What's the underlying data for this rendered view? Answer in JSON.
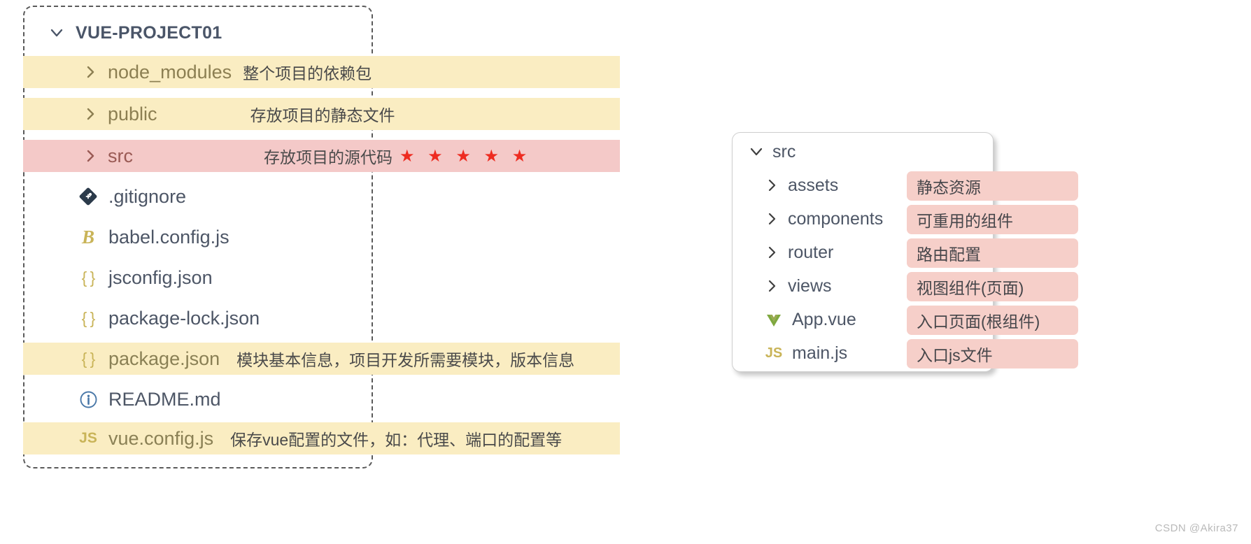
{
  "left_panel": {
    "root": {
      "label": "VUE-PROJECT01",
      "chevron": "chevron-down-icon"
    },
    "rows": [
      {
        "name": "node_modules",
        "note": "整个项目的依赖包",
        "icon": "chevron-right-icon",
        "highlight": "yellow",
        "stars": ""
      },
      {
        "name": "public",
        "note": "存放项目的静态文件",
        "icon": "chevron-right-icon",
        "highlight": "yellow",
        "stars": ""
      },
      {
        "name": "src",
        "note": "存放项目的源代码",
        "icon": "chevron-right-icon",
        "highlight": "pink",
        "stars": "★ ★ ★ ★ ★"
      },
      {
        "name": ".gitignore",
        "note": "",
        "icon": "git-icon",
        "highlight": "none",
        "stars": ""
      },
      {
        "name": "babel.config.js",
        "note": "",
        "icon": "babel-icon",
        "highlight": "none",
        "stars": ""
      },
      {
        "name": "jsconfig.json",
        "note": "",
        "icon": "json-icon",
        "highlight": "none",
        "stars": ""
      },
      {
        "name": "package-lock.json",
        "note": "",
        "icon": "json-icon",
        "highlight": "none",
        "stars": ""
      },
      {
        "name": "package.json",
        "note": "模块基本信息，项目开发所需要模块，版本信息",
        "icon": "json-icon",
        "highlight": "yellow",
        "stars": ""
      },
      {
        "name": "README.md",
        "note": "",
        "icon": "info-icon",
        "highlight": "none",
        "stars": ""
      },
      {
        "name": "vue.config.js",
        "note": "保存vue配置的文件，如：代理、端口的配置等",
        "icon": "js-icon",
        "highlight": "yellow",
        "stars": ""
      }
    ]
  },
  "right_panel": {
    "root": {
      "label": "src",
      "chevron": "chevron-down-icon"
    },
    "rows": [
      {
        "name": "assets",
        "icon": "chevron-right-icon",
        "badge": "静态资源"
      },
      {
        "name": "components",
        "icon": "chevron-right-icon",
        "badge": "可重用的组件"
      },
      {
        "name": "router",
        "icon": "chevron-right-icon",
        "badge": "路由配置"
      },
      {
        "name": "views",
        "icon": "chevron-right-icon",
        "badge": "视图组件(页面)"
      },
      {
        "name": "App.vue",
        "icon": "vue-icon",
        "badge": "入口页面(根组件)"
      },
      {
        "name": "main.js",
        "icon": "js-icon",
        "badge": "入口js文件"
      }
    ]
  },
  "watermark": "CSDN @Akira37",
  "colors": {
    "highlight_yellow": "#faedc2",
    "highlight_pink": "#f4c9c8",
    "badge_pink": "#f6cfc9",
    "star_red": "#ee2b20",
    "text_primary": "#4d5666",
    "icon_yellow": "#c9b458",
    "icon_vue_green": "#7fa83f",
    "icon_git_navy": "#2b3a4a",
    "icon_info_blue": "#4a78a8"
  }
}
